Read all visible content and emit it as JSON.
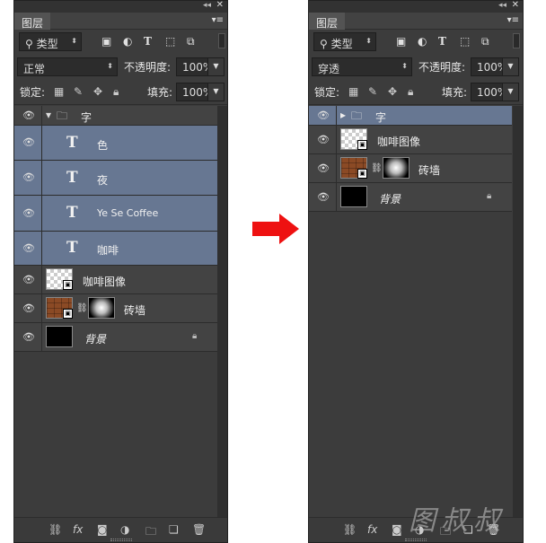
{
  "left_panel": {
    "tab": "图层",
    "filter": {
      "label": "类型"
    },
    "blend_mode": "正常",
    "opacity_label": "不透明度:",
    "opacity_value": "100%",
    "lock_label": "锁定:",
    "fill_label": "填充:",
    "fill_value": "100%",
    "layers": [
      {
        "name": "字",
        "kind": "group"
      },
      {
        "name": "色",
        "kind": "text"
      },
      {
        "name": "夜",
        "kind": "text"
      },
      {
        "name": "Ye Se Coffee",
        "kind": "text"
      },
      {
        "name": "咖啡",
        "kind": "text"
      },
      {
        "name": "咖啡图像",
        "kind": "smart"
      },
      {
        "name": "砖墙",
        "kind": "smart-mask"
      },
      {
        "name": "背景",
        "kind": "background"
      }
    ]
  },
  "right_panel": {
    "tab": "图层",
    "filter": {
      "label": "类型"
    },
    "blend_mode": "穿透",
    "opacity_label": "不透明度:",
    "opacity_value": "100%",
    "lock_label": "锁定:",
    "fill_label": "填充:",
    "fill_value": "100%",
    "layers": [
      {
        "name": "字",
        "kind": "group-collapsed"
      },
      {
        "name": "咖啡图像",
        "kind": "smart"
      },
      {
        "name": "砖墙",
        "kind": "smart-mask"
      },
      {
        "name": "背景",
        "kind": "background"
      }
    ]
  },
  "icons": {
    "text_glyph": "T",
    "eye": "eye-icon",
    "lock": "lock-icon"
  },
  "watermark": "图叔叔",
  "colors": {
    "selected_layer": "#677792",
    "arrow": "#ee1111",
    "panel_bg": "#3c3c3c"
  }
}
